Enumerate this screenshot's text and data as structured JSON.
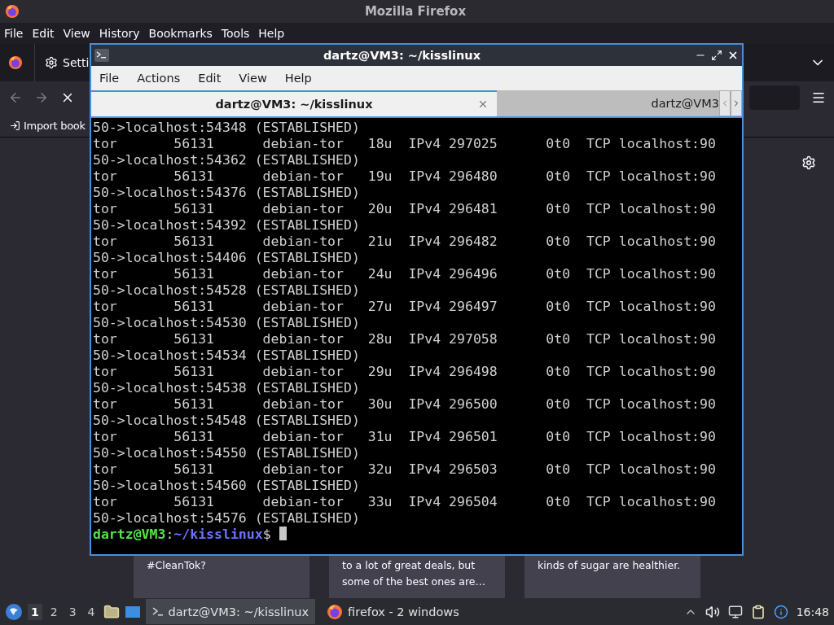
{
  "firefox": {
    "title": "Mozilla Firefox",
    "menu": [
      "File",
      "Edit",
      "View",
      "History",
      "Bookmarks",
      "Tools",
      "Help"
    ],
    "tab_label": "Setti",
    "bookmark": "Import book",
    "cards": [
      {
        "lines": [
          "#CleanTok?"
        ]
      },
      {
        "lines": [
          "to a lot of great deals, but",
          "some of the best ones are…"
        ]
      },
      {
        "lines": [
          "kinds of sugar are healthier."
        ]
      }
    ]
  },
  "terminal": {
    "title": "dartz@VM3: ~/kisslinux",
    "menu": [
      "File",
      "Actions",
      "Edit",
      "View",
      "Help"
    ],
    "tabs": [
      {
        "label": "dartz@VM3: ~/kisslinux",
        "selected": true
      },
      {
        "label": "dartz@VM3",
        "selected": false
      }
    ],
    "lines": [
      "50->localhost:54348 (ESTABLISHED)",
      "tor       56131      debian-tor   18u  IPv4 297025      0t0  TCP localhost:90",
      "50->localhost:54362 (ESTABLISHED)",
      "tor       56131      debian-tor   19u  IPv4 296480      0t0  TCP localhost:90",
      "50->localhost:54376 (ESTABLISHED)",
      "tor       56131      debian-tor   20u  IPv4 296481      0t0  TCP localhost:90",
      "50->localhost:54392 (ESTABLISHED)",
      "tor       56131      debian-tor   21u  IPv4 296482      0t0  TCP localhost:90",
      "50->localhost:54406 (ESTABLISHED)",
      "tor       56131      debian-tor   24u  IPv4 296496      0t0  TCP localhost:90",
      "50->localhost:54528 (ESTABLISHED)",
      "tor       56131      debian-tor   27u  IPv4 296497      0t0  TCP localhost:90",
      "50->localhost:54530 (ESTABLISHED)",
      "tor       56131      debian-tor   28u  IPv4 297058      0t0  TCP localhost:90",
      "50->localhost:54534 (ESTABLISHED)",
      "tor       56131      debian-tor   29u  IPv4 296498      0t0  TCP localhost:90",
      "50->localhost:54538 (ESTABLISHED)",
      "tor       56131      debian-tor   30u  IPv4 296500      0t0  TCP localhost:90",
      "50->localhost:54548 (ESTABLISHED)",
      "tor       56131      debian-tor   31u  IPv4 296501      0t0  TCP localhost:90",
      "50->localhost:54550 (ESTABLISHED)",
      "tor       56131      debian-tor   32u  IPv4 296503      0t0  TCP localhost:90",
      "50->localhost:54560 (ESTABLISHED)",
      "tor       56131      debian-tor   33u  IPv4 296504      0t0  TCP localhost:90",
      "50->localhost:54576 (ESTABLISHED)"
    ],
    "prompt": {
      "user": "dartz@VM3",
      "separator": ":",
      "path": "~/kisslinux",
      "symbol": "$"
    }
  },
  "taskbar": {
    "workspaces": [
      {
        "label": "1",
        "selected": true
      },
      {
        "label": "2",
        "selected": false
      },
      {
        "label": "3",
        "selected": false
      },
      {
        "label": "4",
        "selected": false
      }
    ],
    "tasks": [
      {
        "label": "dartz@VM3: ~/kisslinux",
        "kind": "terminal",
        "selected": true
      },
      {
        "label": "firefox - 2 windows",
        "kind": "firefox",
        "selected": false
      }
    ],
    "clock": "16:48"
  }
}
